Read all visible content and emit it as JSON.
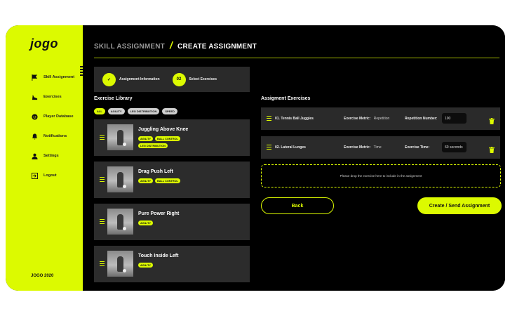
{
  "brand": {
    "logo": "jogo",
    "footer": "JOGO 2020"
  },
  "sidebar": {
    "items": [
      {
        "label": "Skill Assignment",
        "icon": "flag-icon"
      },
      {
        "label": "Exercises",
        "icon": "boot-icon"
      },
      {
        "label": "Player Database",
        "icon": "smile-icon"
      },
      {
        "label": "Notifications",
        "icon": "bell-icon"
      },
      {
        "label": "Settings",
        "icon": "user-icon"
      },
      {
        "label": "Logout",
        "icon": "logout-icon"
      }
    ]
  },
  "header": {
    "crumb1": "SKILL ASSIGNMENT",
    "separator": "/",
    "crumb2": "CREATE ASSIGNMENT"
  },
  "steps": [
    {
      "badge": "✓",
      "label": "Assignment Information"
    },
    {
      "badge": "02",
      "label": "Select Exercises"
    }
  ],
  "library": {
    "title": "Exercise Library",
    "filters": [
      "ALL",
      "AGILITY",
      "LEG DISTRIBUTION",
      "SPEED"
    ],
    "exercises": [
      {
        "name": "Juggling Above Knee",
        "tags": [
          "AGILITY",
          "BALL CONTROL",
          "LEG DISTRIBUTION"
        ]
      },
      {
        "name": "Drag Push Left",
        "tags": [
          "AGILITY",
          "BALL CONTROL"
        ]
      },
      {
        "name": "Pure Power Right",
        "tags": [
          "AGILITY"
        ]
      },
      {
        "name": "Touch Inside Left",
        "tags": [
          "AGILITY"
        ]
      }
    ]
  },
  "assignment": {
    "title": "Assigment Exercises",
    "rows": [
      {
        "name": "01. Tennis Ball Juggles",
        "metric_label": "Exercise Metric:",
        "metric": "Repetition",
        "field_label": "Repetition Number:",
        "value": "100"
      },
      {
        "name": "02. Lateral Lunges",
        "metric_label": "Exercise Metric:",
        "metric": "Time",
        "field_label": "Exercise Time:",
        "value": "60 seconds"
      }
    ],
    "dropzone": "Please drop the exercise here to include in the assignment"
  },
  "buttons": {
    "back": "Back",
    "create": "Create / Send Assignment"
  },
  "colors": {
    "accent": "#dcfa00",
    "background": "#000000",
    "card": "#2c2c2c"
  }
}
